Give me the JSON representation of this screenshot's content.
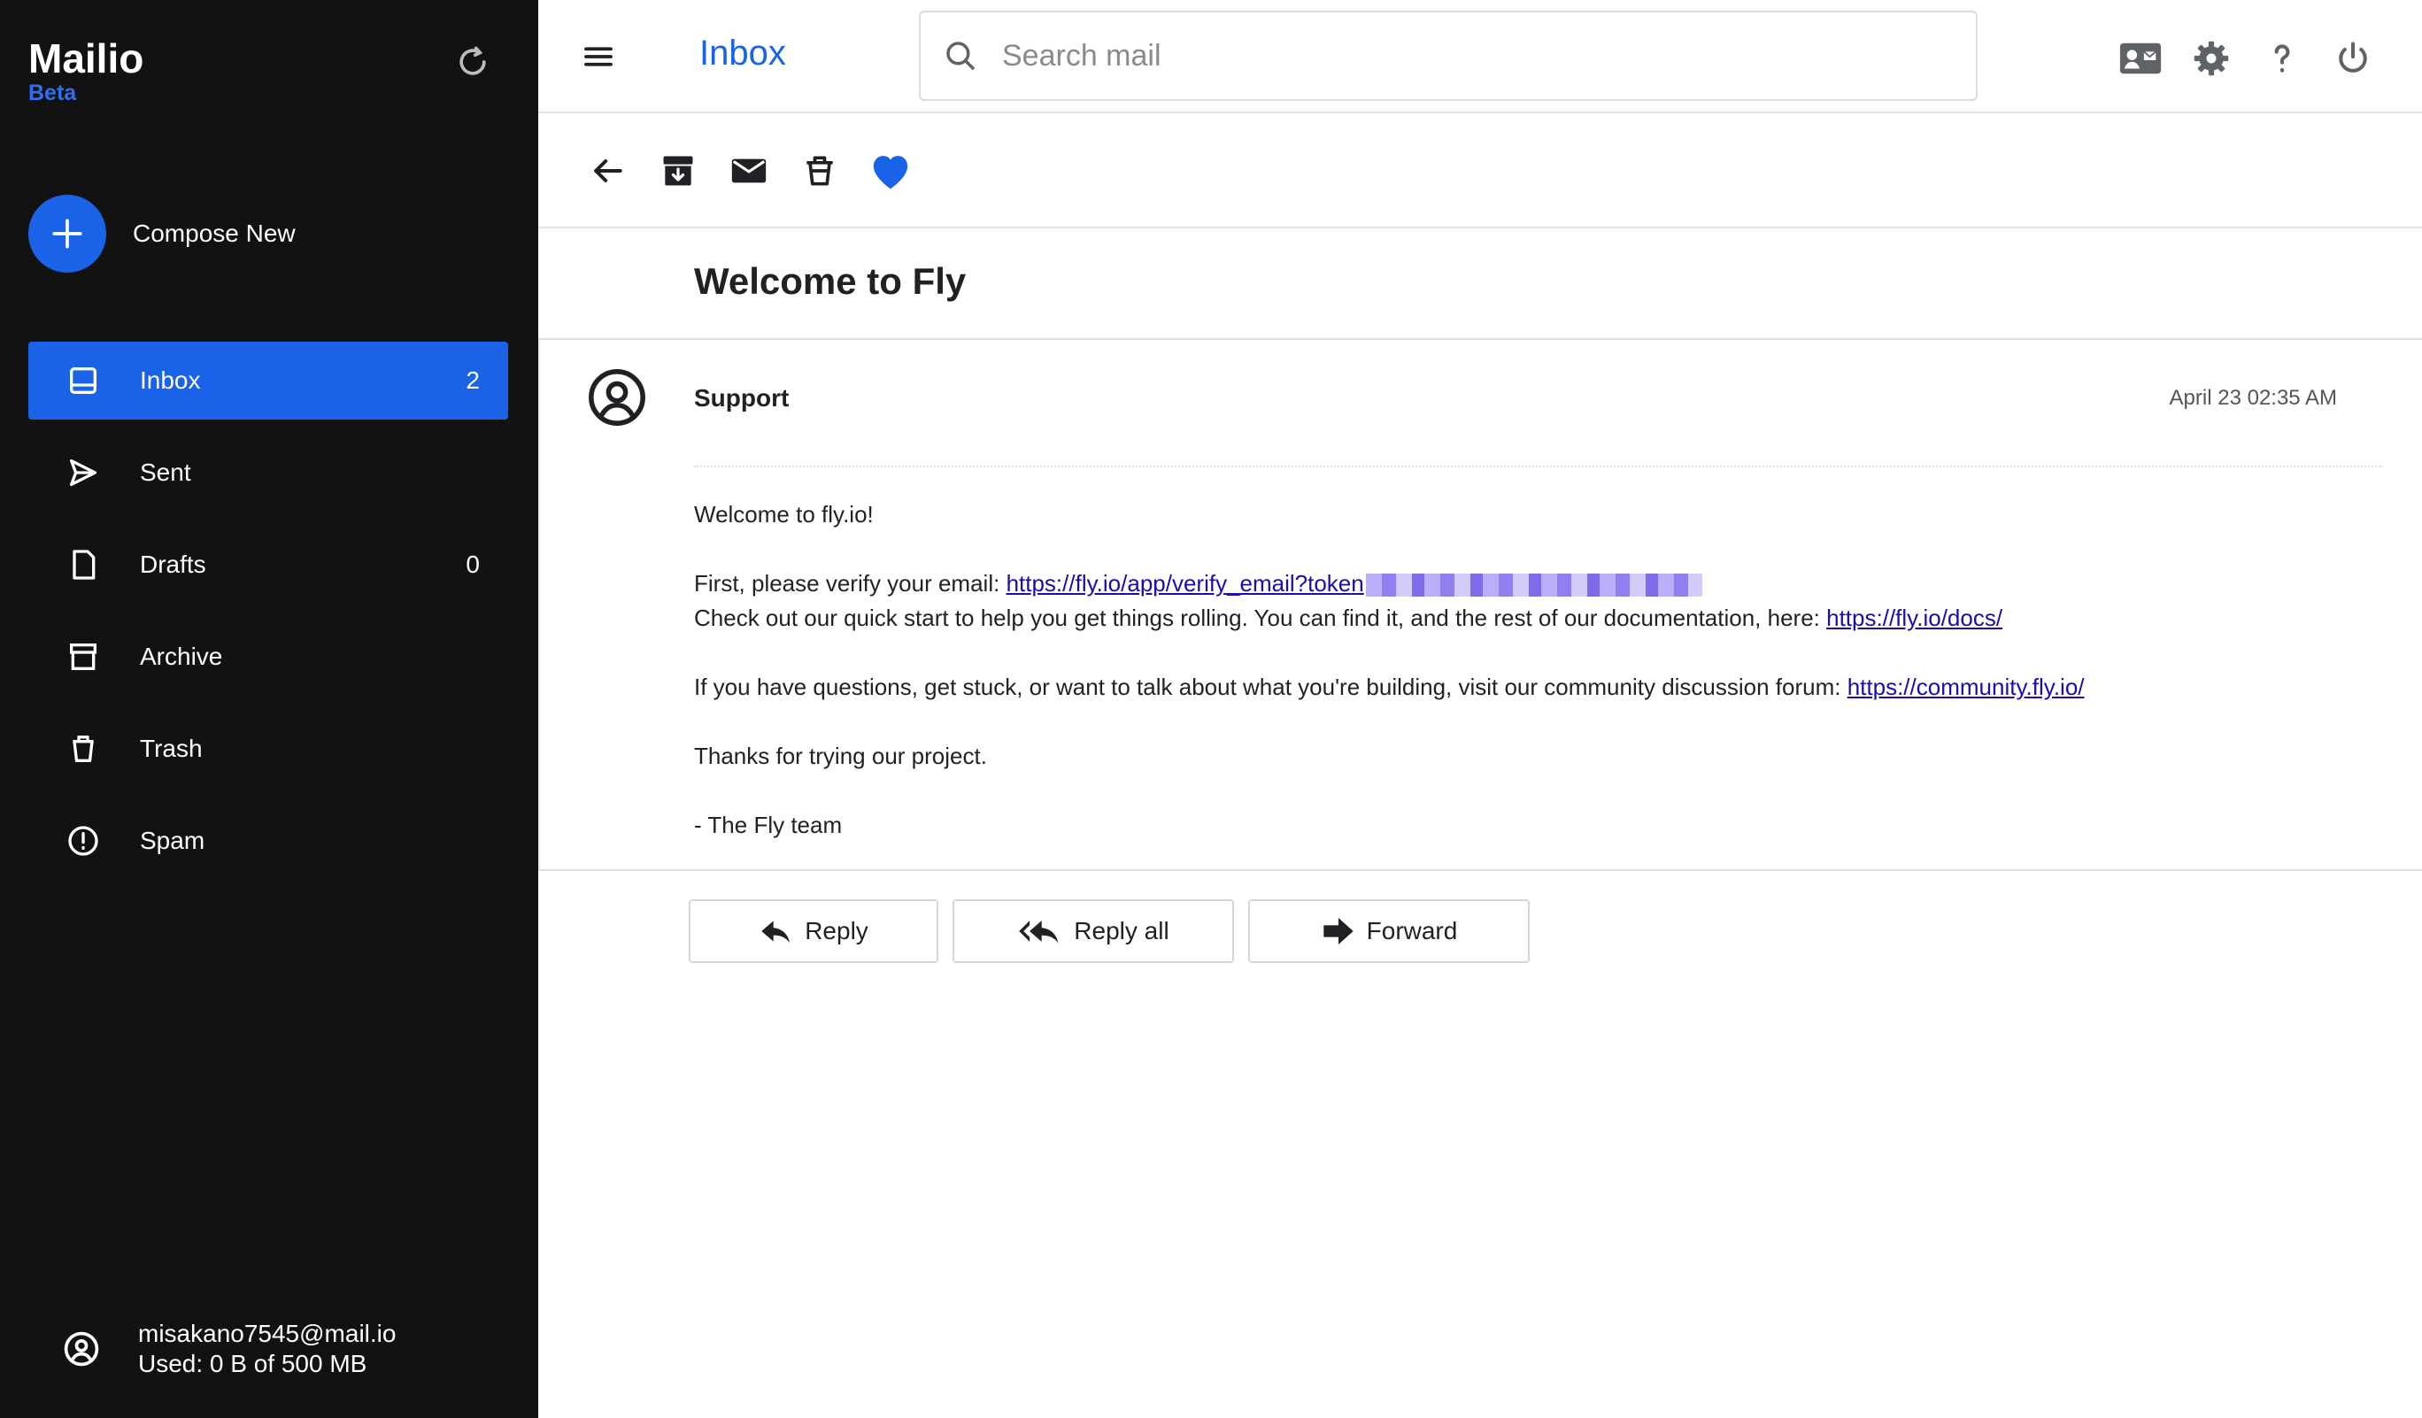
{
  "sidebar": {
    "brand": "Mailio",
    "beta": "Beta",
    "compose_label": "Compose New",
    "items": [
      {
        "label": "Inbox",
        "count": "2",
        "icon": "inbox-icon",
        "active": true
      },
      {
        "label": "Sent",
        "count": "",
        "icon": "send-icon"
      },
      {
        "label": "Drafts",
        "count": "0",
        "icon": "draft-icon"
      },
      {
        "label": "Archive",
        "count": "",
        "icon": "archive-icon"
      },
      {
        "label": "Trash",
        "count": "",
        "icon": "trash-icon"
      },
      {
        "label": "Spam",
        "count": "",
        "icon": "spam-icon"
      }
    ],
    "account": {
      "email": "misakano7545@mail.io",
      "usage": "Used: 0 B of 500 MB"
    }
  },
  "header": {
    "title": "Inbox",
    "search_placeholder": "Search mail"
  },
  "colors": {
    "accent": "#1a62e8",
    "sidebar_bg": "#121212",
    "favorite": "#1a62e8"
  },
  "message": {
    "subject": "Welcome to Fly",
    "sender": "Support",
    "date": "April 23 02:35 AM",
    "greeting": "Welcome to fly.io!",
    "verify_prefix": "First, please verify your email: ",
    "verify_link": "https://fly.io/app/verify_email?token",
    "docs_prefix": "Check out our quick start to help you get things rolling. You can find it, and the rest of our documentation, here: ",
    "docs_link": "https://fly.io/docs/",
    "community_prefix": "If you have questions, get stuck, or want to talk about what you're building, visit our community discussion forum: ",
    "community_link": "https://community.fly.io/",
    "thanks": "Thanks for trying our project.",
    "signoff": "- The Fly team"
  },
  "actions": {
    "reply": "Reply",
    "reply_all": "Reply all",
    "forward": "Forward"
  }
}
